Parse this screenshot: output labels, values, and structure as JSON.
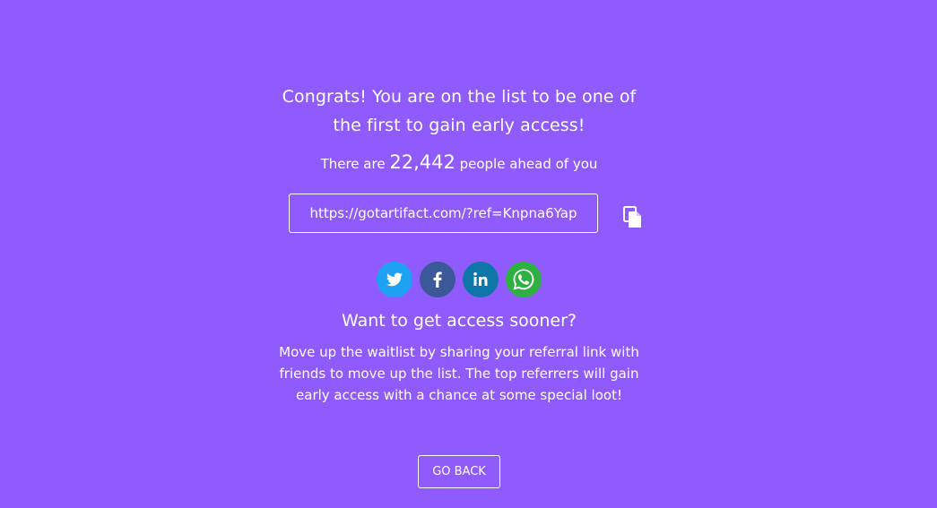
{
  "headline": "Congrats! You are on the list to be one of the first to gain early access!",
  "ahead": {
    "prefix": "There are",
    "count": "22,442",
    "suffix": "people ahead of you"
  },
  "referral": {
    "url": "https://gotartifact.com/?ref=Knpna6Yap",
    "copy_icon": "copy-icon"
  },
  "social": [
    {
      "name": "twitter",
      "icon": "twitter-icon",
      "color": "#1da1f2"
    },
    {
      "name": "facebook",
      "icon": "facebook-icon",
      "color": "#3b5998"
    },
    {
      "name": "linkedin",
      "icon": "linkedin-icon",
      "color": "#0e76a8"
    },
    {
      "name": "whatsapp",
      "icon": "whatsapp-icon",
      "color": "#2fb142"
    }
  ],
  "sooner": {
    "title": "Want to get access sooner?",
    "description": "Move up the waitlist by sharing your referral link with friends to move up the list. The top referrers will gain early access with a chance at some special loot!"
  },
  "go_back_label": "GO BACK",
  "colors": {
    "background": "#8f5bfd",
    "text": "#ffffff"
  }
}
